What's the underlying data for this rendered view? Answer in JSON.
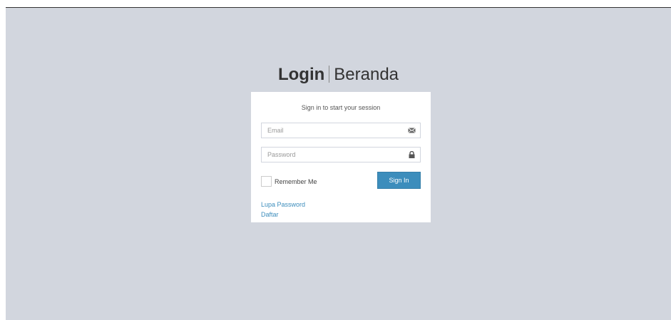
{
  "brand": {
    "title_bold": "Login",
    "title_rest": "Beranda"
  },
  "login": {
    "message": "Sign in to start your session",
    "email_placeholder": "Email",
    "password_placeholder": "Password",
    "remember_label": "Remember Me",
    "signin_label": "Sign In",
    "forgot_link": "Lupa Password",
    "register_link": "Daftar"
  },
  "icons": {
    "email": "envelope-icon",
    "password": "lock-icon"
  },
  "colors": {
    "background": "#d2d6de",
    "primary": "#3c8dbc",
    "box": "#ffffff"
  }
}
